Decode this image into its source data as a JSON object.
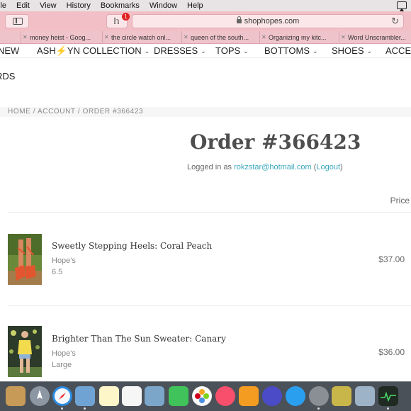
{
  "menubar": {
    "items": [
      "ile",
      "Edit",
      "View",
      "History",
      "Bookmarks",
      "Window",
      "Help"
    ]
  },
  "toolbar": {
    "reader_badge": "1",
    "url": "shophopes.com"
  },
  "bookmarks": [
    "money heist - Goog...",
    "the circle watch onl...",
    "queen of the south...",
    "Organizing my kitc...",
    "Word Unscrambler..."
  ],
  "site_nav": {
    "items": [
      {
        "label": "NEW",
        "has_menu": false
      },
      {
        "label": "ASH⚡YN COLLECTION",
        "has_menu": true
      },
      {
        "label": "DRESSES",
        "has_menu": true
      },
      {
        "label": "TOPS",
        "has_menu": true
      },
      {
        "label": "BOTTOMS",
        "has_menu": true
      },
      {
        "label": "SHOES",
        "has_menu": true
      },
      {
        "label": "ACCES",
        "has_menu": false
      }
    ],
    "second_row": "RDS"
  },
  "breadcrumb": "HOME / ACCOUNT / ORDER #366423",
  "order": {
    "title": "Order #366423",
    "logged_prefix": "Logged in as ",
    "email": "rokzstar@hotmail.com",
    "logout_open": " (",
    "logout_label": "Logout",
    "logout_close": ")",
    "price_header": "Price"
  },
  "items": [
    {
      "title": "Sweetly Stepping Heels: Coral Peach",
      "brand": "Hope's",
      "variant": "6.5",
      "price": "$37.00"
    },
    {
      "title": "Brighter Than The Sun Sweater: Canary",
      "brand": "Hope's",
      "variant": "Large",
      "price": "$36.00"
    }
  ],
  "dock": {
    "apps": [
      "finder-app",
      "launchpad-app",
      "safari-app",
      "preview-app",
      "notes-app",
      "reminders-app",
      "photo-viewer-app",
      "facetime-app",
      "photos-app",
      "itunes-app",
      "ibooks-app",
      "siri-app",
      "app-store-app",
      "system-preferences-app",
      "utility-app",
      "photo-app",
      "activity-monitor-app"
    ]
  },
  "colors": {
    "toolbar": "#f3bfc7",
    "link": "#3aa8bc",
    "title": "#4e4e4e"
  }
}
